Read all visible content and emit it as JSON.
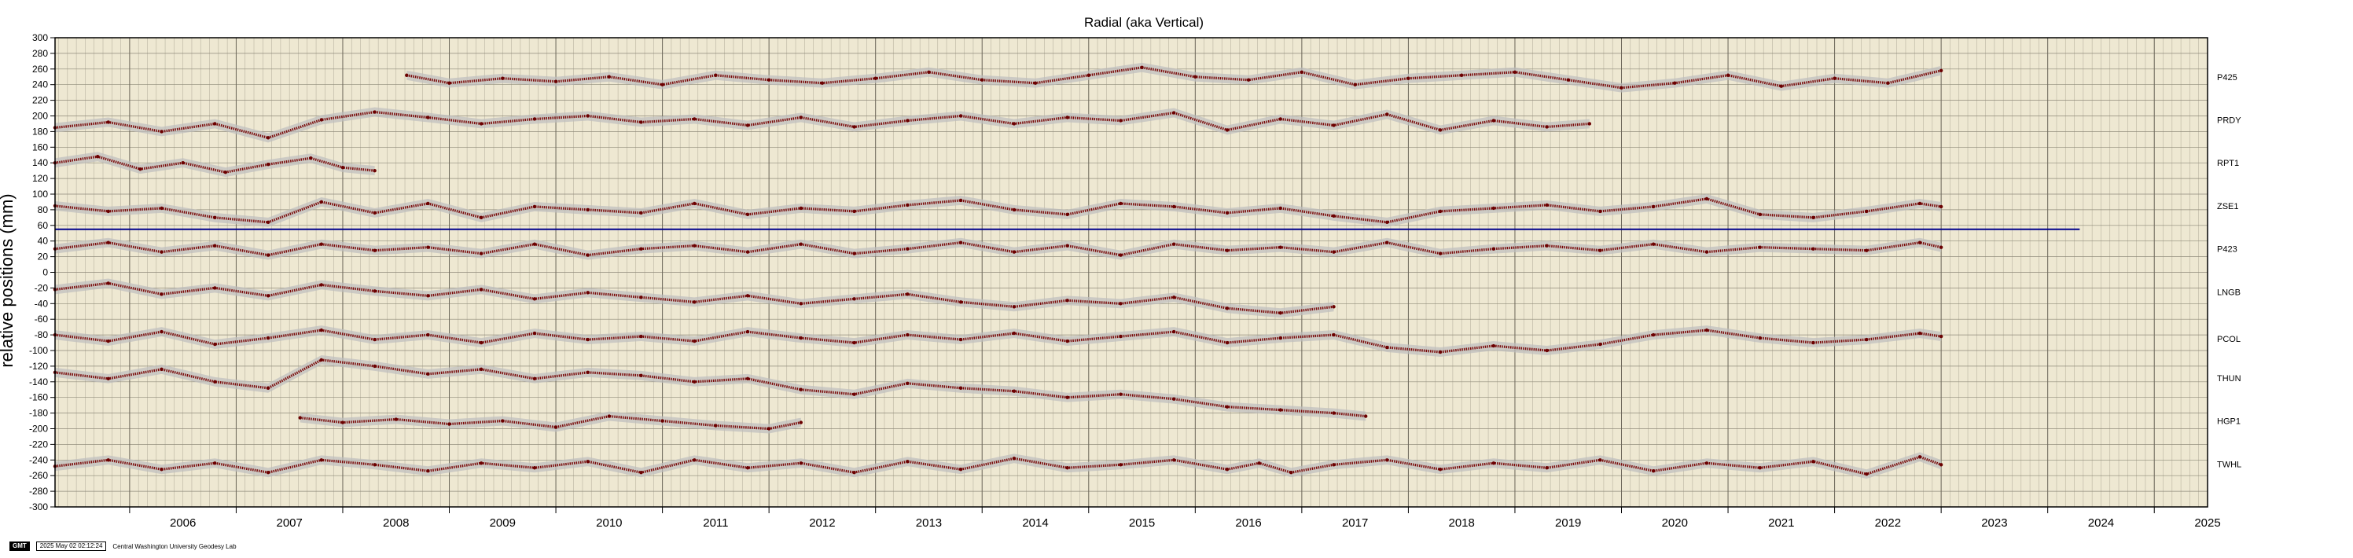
{
  "chart_data": {
    "type": "scatter",
    "title": "Radial (aka Vertical)",
    "xlabel": "",
    "ylabel": "relative positions (mm)",
    "xlim": [
      2005.3,
      2025.5
    ],
    "ylim": [
      -300,
      300
    ],
    "y_tick_step": 20,
    "x_ticks": [
      "2006",
      "2007",
      "2008",
      "2009",
      "2010",
      "2011",
      "2012",
      "2013",
      "2014",
      "2015",
      "2016",
      "2017",
      "2018",
      "2019",
      "2020",
      "2021",
      "2022",
      "2023",
      "2024",
      "2025"
    ],
    "grid": true,
    "reference_line": {
      "y": 55,
      "x_start": 2005.3,
      "x_end": 2024.3,
      "color": "#00008b"
    },
    "series": [
      {
        "name": "P425",
        "offset": 250,
        "x": [
          2008.6,
          2009.0,
          2009.5,
          2010.0,
          2010.5,
          2011.0,
          2011.5,
          2012.0,
          2012.5,
          2013.0,
          2013.5,
          2014.0,
          2014.5,
          2015.0,
          2015.5,
          2016.0,
          2016.5,
          2017.0,
          2017.5,
          2018.0,
          2018.5,
          2019.0,
          2019.5,
          2020.0,
          2020.5,
          2021.0,
          2021.5,
          2022.0,
          2022.5,
          2023.0
        ],
        "y": [
          252,
          242,
          248,
          244,
          250,
          240,
          252,
          246,
          242,
          248,
          256,
          246,
          242,
          252,
          262,
          250,
          246,
          256,
          240,
          248,
          252,
          256,
          246,
          236,
          242,
          252,
          238,
          248,
          242,
          258
        ]
      },
      {
        "name": "PRDY",
        "offset": 195,
        "x": [
          2005.3,
          2005.8,
          2006.3,
          2006.8,
          2007.3,
          2007.8,
          2008.3,
          2008.8,
          2009.3,
          2009.8,
          2010.3,
          2010.8,
          2011.3,
          2011.8,
          2012.3,
          2012.8,
          2013.3,
          2013.8,
          2014.3,
          2014.8,
          2015.3,
          2015.8,
          2016.3,
          2016.8,
          2017.3,
          2017.8,
          2018.3,
          2018.8,
          2019.3,
          2019.7
        ],
        "y": [
          185,
          192,
          180,
          190,
          172,
          195,
          205,
          198,
          190,
          196,
          200,
          192,
          196,
          188,
          198,
          186,
          194,
          200,
          190,
          198,
          194,
          204,
          182,
          196,
          188,
          202,
          182,
          194,
          186,
          190
        ]
      },
      {
        "name": "RPT1",
        "offset": 140,
        "x": [
          2005.3,
          2005.7,
          2006.1,
          2006.5,
          2006.9,
          2007.3,
          2007.7,
          2008.0,
          2008.3
        ],
        "y": [
          140,
          148,
          132,
          140,
          128,
          138,
          146,
          134,
          130
        ]
      },
      {
        "name": "ZSE1",
        "offset": 85,
        "x": [
          2005.3,
          2005.8,
          2006.3,
          2006.8,
          2007.3,
          2007.8,
          2008.3,
          2008.8,
          2009.3,
          2009.8,
          2010.3,
          2010.8,
          2011.3,
          2011.8,
          2012.3,
          2012.8,
          2013.3,
          2013.8,
          2014.3,
          2014.8,
          2015.3,
          2015.8,
          2016.3,
          2016.8,
          2017.3,
          2017.8,
          2018.3,
          2018.8,
          2019.3,
          2019.8,
          2020.3,
          2020.8,
          2021.3,
          2021.8,
          2022.3,
          2022.8,
          2023.0
        ],
        "y": [
          85,
          78,
          82,
          70,
          64,
          90,
          76,
          88,
          70,
          84,
          80,
          76,
          88,
          74,
          82,
          78,
          86,
          92,
          80,
          74,
          88,
          84,
          76,
          82,
          72,
          64,
          78,
          82,
          86,
          78,
          84,
          94,
          74,
          70,
          78,
          88,
          84
        ]
      },
      {
        "name": "P423",
        "offset": 30,
        "x": [
          2005.3,
          2005.8,
          2006.3,
          2006.8,
          2007.3,
          2007.8,
          2008.3,
          2008.8,
          2009.3,
          2009.8,
          2010.3,
          2010.8,
          2011.3,
          2011.8,
          2012.3,
          2012.8,
          2013.3,
          2013.8,
          2014.3,
          2014.8,
          2015.3,
          2015.8,
          2016.3,
          2016.8,
          2017.3,
          2017.8,
          2018.3,
          2018.8,
          2019.3,
          2019.8,
          2020.3,
          2020.8,
          2021.3,
          2021.8,
          2022.3,
          2022.8,
          2023.0
        ],
        "y": [
          30,
          38,
          26,
          34,
          22,
          36,
          28,
          32,
          24,
          36,
          22,
          30,
          34,
          26,
          36,
          24,
          30,
          38,
          26,
          34,
          22,
          36,
          28,
          32,
          26,
          38,
          24,
          30,
          34,
          28,
          36,
          26,
          32,
          30,
          28,
          38,
          32
        ]
      },
      {
        "name": "LNGB",
        "offset": -25,
        "x": [
          2005.3,
          2005.8,
          2006.3,
          2006.8,
          2007.3,
          2007.8,
          2008.3,
          2008.8,
          2009.3,
          2009.8,
          2010.3,
          2010.8,
          2011.3,
          2011.8,
          2012.3,
          2012.8,
          2013.3,
          2013.8,
          2014.3,
          2014.8,
          2015.3,
          2015.8,
          2016.3,
          2016.8,
          2017.3
        ],
        "y": [
          -22,
          -14,
          -28,
          -20,
          -30,
          -16,
          -24,
          -30,
          -22,
          -34,
          -26,
          -32,
          -38,
          -30,
          -40,
          -34,
          -28,
          -38,
          -44,
          -36,
          -40,
          -32,
          -46,
          -52,
          -44
        ]
      },
      {
        "name": "PCOL",
        "offset": -85,
        "x": [
          2005.3,
          2005.8,
          2006.3,
          2006.8,
          2007.3,
          2007.8,
          2008.3,
          2008.8,
          2009.3,
          2009.8,
          2010.3,
          2010.8,
          2011.3,
          2011.8,
          2012.3,
          2012.8,
          2013.3,
          2013.8,
          2014.3,
          2014.8,
          2015.3,
          2015.8,
          2016.3,
          2016.8,
          2017.3,
          2017.8,
          2018.3,
          2018.8,
          2019.3,
          2019.8,
          2020.3,
          2020.8,
          2021.3,
          2021.8,
          2022.3,
          2022.8,
          2023.0
        ],
        "y": [
          -80,
          -88,
          -76,
          -92,
          -84,
          -74,
          -86,
          -80,
          -90,
          -78,
          -86,
          -82,
          -88,
          -76,
          -84,
          -90,
          -80,
          -86,
          -78,
          -88,
          -82,
          -76,
          -90,
          -84,
          -80,
          -96,
          -102,
          -94,
          -100,
          -92,
          -80,
          -74,
          -84,
          -90,
          -86,
          -78,
          -82
        ]
      },
      {
        "name": "THUN",
        "offset": -135,
        "x": [
          2005.3,
          2005.8,
          2006.3,
          2006.8,
          2007.3,
          2007.8,
          2008.3,
          2008.8,
          2009.3,
          2009.8,
          2010.3,
          2010.8,
          2011.3,
          2011.8,
          2012.3,
          2012.8,
          2013.3,
          2013.8,
          2014.3,
          2014.8,
          2015.3,
          2015.8,
          2016.3,
          2016.8,
          2017.3,
          2017.6
        ],
        "y": [
          -128,
          -136,
          -124,
          -140,
          -148,
          -112,
          -120,
          -130,
          -124,
          -136,
          -128,
          -132,
          -140,
          -136,
          -150,
          -156,
          -142,
          -148,
          -152,
          -160,
          -156,
          -162,
          -172,
          -176,
          -180,
          -184
        ]
      },
      {
        "name": "HGP1",
        "offset": -190,
        "x": [
          2007.6,
          2008.0,
          2008.5,
          2009.0,
          2009.5,
          2010.0,
          2010.5,
          2011.0,
          2011.5,
          2012.0,
          2012.3
        ],
        "y": [
          -186,
          -192,
          -188,
          -194,
          -190,
          -198,
          -184,
          -190,
          -196,
          -200,
          -192
        ]
      },
      {
        "name": "TWHL",
        "offset": -245,
        "x": [
          2005.3,
          2005.8,
          2006.3,
          2006.8,
          2007.3,
          2007.8,
          2008.3,
          2008.8,
          2009.3,
          2009.8,
          2010.3,
          2010.8,
          2011.3,
          2011.8,
          2012.3,
          2012.8,
          2013.3,
          2013.8,
          2014.3,
          2014.8,
          2015.3,
          2015.8,
          2016.3,
          2016.6,
          2016.9,
          2017.3,
          2017.8,
          2018.3,
          2018.8,
          2019.3,
          2019.8,
          2020.3,
          2020.8,
          2021.3,
          2021.8,
          2022.3,
          2022.8,
          2023.0
        ],
        "y": [
          -248,
          -240,
          -252,
          -244,
          -256,
          -240,
          -246,
          -254,
          -244,
          -250,
          -242,
          -256,
          -240,
          -250,
          -244,
          -256,
          -242,
          -252,
          -238,
          -250,
          -246,
          -240,
          -252,
          -244,
          -256,
          -246,
          -240,
          -252,
          -244,
          -250,
          -240,
          -254,
          -244,
          -250,
          -242,
          -258,
          -236,
          -246
        ]
      }
    ]
  },
  "footer": {
    "logo": "GMT",
    "timestamp": "2025 May 02 02:12:24",
    "credit": "Central Washington University Geodesy Lab"
  }
}
